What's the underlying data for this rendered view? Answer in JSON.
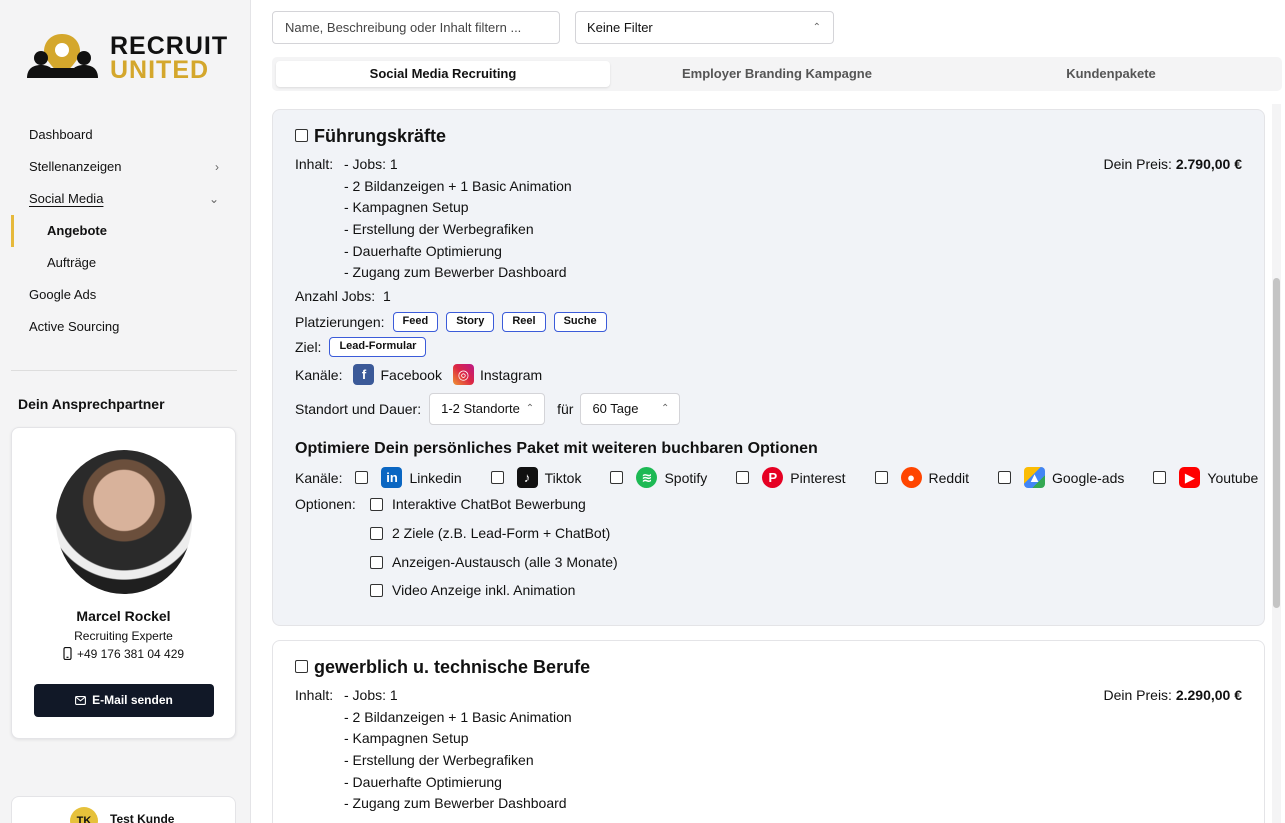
{
  "logo": {
    "line1": "RECRUIT",
    "line2": "UNITED"
  },
  "sidebar": {
    "items": [
      {
        "label": "Dashboard"
      },
      {
        "label": "Stellenanzeigen",
        "chevron": "›"
      },
      {
        "label": "Social Media",
        "chevron": "⌄"
      },
      {
        "label": "Angebote"
      },
      {
        "label": "Aufträge"
      },
      {
        "label": "Google Ads"
      },
      {
        "label": "Active Sourcing"
      }
    ]
  },
  "contact": {
    "title": "Dein Ansprechpartner",
    "name": "Marcel Rockel",
    "role": "Recruiting Experte",
    "phone": "+49 176 381 04 429",
    "email_button": "E-Mail senden"
  },
  "user": {
    "initials": "TK",
    "name": "Test Kunde"
  },
  "search": {
    "placeholder": "Name, Beschreibung oder Inhalt filtern ..."
  },
  "filter": {
    "value": "Keine Filter"
  },
  "tabs": [
    {
      "label": "Social Media Recruiting"
    },
    {
      "label": "Employer Branding Kampagne"
    },
    {
      "label": "Kundenpakete"
    }
  ],
  "cards": [
    {
      "title": "Führungskräfte",
      "inhalt_label": "Inhalt:",
      "items": [
        "- Jobs: 1",
        "- 2 Bildanzeigen + 1 Basic Animation",
        "- Kampagnen Setup",
        "- Erstellung der Werbegrafiken",
        "- Dauerhafte Optimierung",
        "- Zugang zum Bewerber Dashboard"
      ],
      "price_label": "Dein Preis:",
      "price": "2.790,00 €",
      "jobs_label": "Anzahl Jobs:",
      "jobs_value": "1",
      "placements_label": "Platzierungen:",
      "placements": [
        "Feed",
        "Story",
        "Reel",
        "Suche"
      ],
      "goal_label": "Ziel:",
      "goal": "Lead-Formular",
      "channels_label": "Kanäle:",
      "channels": [
        {
          "name": "Facebook",
          "icon": "facebook-icon",
          "color": "#3b5998"
        },
        {
          "name": "Instagram",
          "icon": "instagram-icon",
          "color": "#d6249f"
        }
      ],
      "location_label": "Standort und Dauer:",
      "location_value": "1-2 Standorte",
      "for_label": "für",
      "duration_value": "60 Tage",
      "optimize_title": "Optimiere Dein persönliches Paket mit weiteren buchbaren Optionen",
      "extra_channels_label": "Kanäle:",
      "extra_channels": [
        {
          "name": "Linkedin",
          "icon": "linkedin-icon",
          "color": "#0a66c2"
        },
        {
          "name": "Tiktok",
          "icon": "tiktok-icon",
          "color": "#111111"
        },
        {
          "name": "Spotify",
          "icon": "spotify-icon",
          "color": "#1db954"
        },
        {
          "name": "Pinterest",
          "icon": "pinterest-icon",
          "color": "#e60023"
        },
        {
          "name": "Reddit",
          "icon": "reddit-icon",
          "color": "#ff4500"
        },
        {
          "name": "Google-ads",
          "icon": "google-ads-icon",
          "color": "#4285f4"
        },
        {
          "name": "Youtube",
          "icon": "youtube-icon",
          "color": "#ff0000"
        }
      ],
      "options_label": "Optionen:",
      "options": [
        "Interaktive ChatBot Bewerbung",
        "2 Ziele (z.B. Lead-Form + ChatBot)",
        "Anzeigen-Austausch (alle 3 Monate)",
        "Video Anzeige inkl. Animation"
      ]
    },
    {
      "title": "gewerblich u. technische Berufe",
      "inhalt_label": "Inhalt:",
      "items": [
        "- Jobs: 1",
        "- 2 Bildanzeigen + 1 Basic Animation",
        "- Kampagnen Setup",
        "- Erstellung der Werbegrafiken",
        "- Dauerhafte Optimierung",
        "- Zugang zum Bewerber Dashboard"
      ],
      "price_label": "Dein Preis:",
      "price": "2.290,00 €"
    }
  ]
}
